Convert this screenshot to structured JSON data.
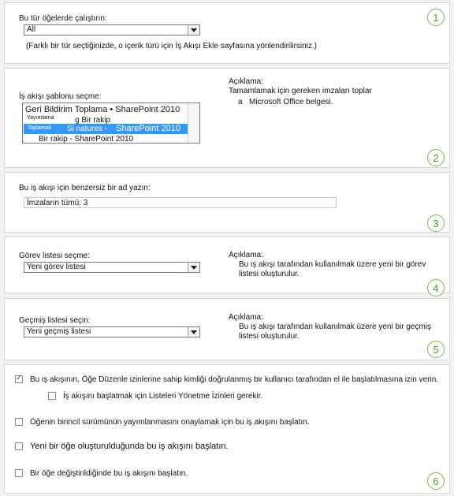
{
  "section1": {
    "label": "Bu tür öğelerde çalıştırın:",
    "select_value": "All",
    "note": "(Farklı bir tür seçtiğinizde, o içerik türü için İş Akışı Ekle sayfasına yönlendirilirsiniz.)",
    "number": "1"
  },
  "section2": {
    "label": "İş akışı şablonu seçme:",
    "list_items": [
      "Geri Bildirim Toplama • SharePoint 2010",
      "Yayımlama",
      "g Bir rakip",
      "Toplamak",
      "Si natures -",
      "SharePoint 2010",
      "Bir rakip - SharePoint 2010"
    ],
    "desc_title": "Açıklama:",
    "desc_line1": "Tamamlamak için gereken imzaları toplar",
    "desc_a": "a",
    "desc_line2": "Microsoft Office belgesi.",
    "number": "2"
  },
  "section3": {
    "label": "Bu iş akışı için benzersiz bir ad yazın:",
    "input_value": "İmzaların tümü: 3",
    "number": "3"
  },
  "section4": {
    "label": "Görev listesi seçme:",
    "select_value": "Yeni görev listesi",
    "desc_title": "Açıklama:",
    "desc_line1": "Bu iş akışı tarafından kullanılmak üzere yeni bir görev",
    "desc_line2": "listesi oluşturulur.",
    "number": "4"
  },
  "section5": {
    "label": "Geçmiş listesi seçin:",
    "select_value": "Yeni geçmiş listesi",
    "desc_title": "Açıklama:",
    "desc_line1": "Bu iş akışı tarafından kullanılmak üzere yeni bir geçmiş",
    "desc_line2": "listesi oluşturulur.",
    "number": "5"
  },
  "section6": {
    "options": [
      {
        "label": "Bu iş akışının, Öğe Düzenle izinlerine sahip kimliği doğrulanmış bir kullanıcı tarafından el ile başlatılmasına izin verin.",
        "checked": true
      },
      {
        "label": "İş akışını başlatmak için Listeleri Yönetme İzinleri gerekir.",
        "checked": false
      },
      {
        "label": "Öğenin birincil sürümünün yayımlanmasını onaylamak için bu iş akışını başlatın.",
        "checked": false
      },
      {
        "label": "Yeni bir öğe oluşturulduğunda bu iş akışını başlatın.",
        "checked": false
      },
      {
        "label": "Bir öğe değiştirildiğinde bu iş akışını başlatın.",
        "checked": false
      }
    ],
    "number": "6"
  }
}
